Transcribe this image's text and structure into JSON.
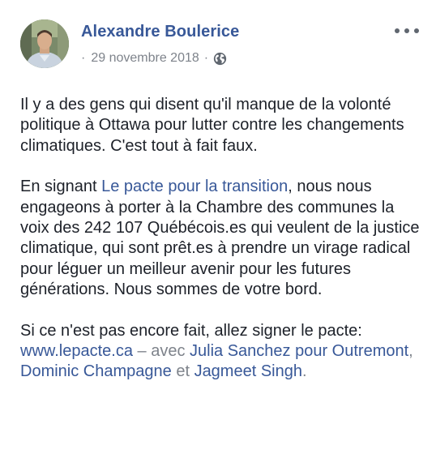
{
  "post": {
    "author": "Alexandre Boulerice",
    "dot": "·",
    "date": "29 novembre 2018",
    "dot2": "·",
    "privacy_icon": "globe-icon",
    "more_icon": "more-options-icon",
    "paragraphs": {
      "p1": "Il y a des gens qui disent qu'il manque de la volonté politique à Ottawa pour lutter contre les changements climatiques. C'est tout à fait faux.",
      "p2_before": "En signant ",
      "p2_link": "Le pacte pour la transition",
      "p2_after": ", nous nous engageons à porter à la Chambre des communes la voix des 242 107 Québécois.es qui veulent de la justice climatique, qui sont prêt.es à prendre un virage radical pour léguer un meilleur avenir pour les futures générations. Nous sommes de votre bord.",
      "p3_before": "Si ce n'est pas encore fait, allez signer le pacte: ",
      "p3_url": "www.lepacte.ca",
      "p3_with": " – avec ",
      "p3_tag1": "Julia Sanchez pour Outremont",
      "p3_comma": ", ",
      "p3_tag2": "Dominic Champagne",
      "p3_and": " et ",
      "p3_tag3": "Jagmeet Singh",
      "p3_period": "."
    }
  },
  "colors": {
    "link": "#385898",
    "text": "#1d2129",
    "muted": "#7e838b"
  }
}
